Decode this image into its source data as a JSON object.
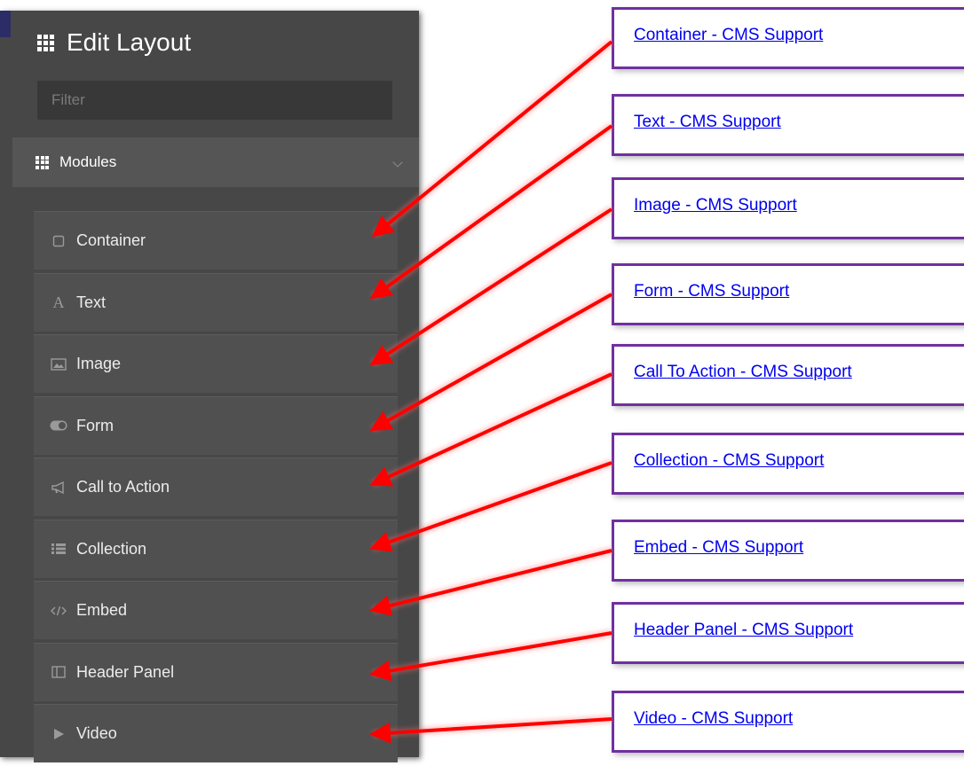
{
  "sidebar": {
    "title": "Edit Layout",
    "filter_placeholder": "Filter",
    "section_label": "Modules",
    "items": [
      {
        "label": "Container",
        "icon": "square-outline-icon"
      },
      {
        "label": "Text",
        "icon": "text-a-icon"
      },
      {
        "label": "Image",
        "icon": "image-icon"
      },
      {
        "label": "Form",
        "icon": "toggle-icon"
      },
      {
        "label": "Call to Action",
        "icon": "megaphone-icon"
      },
      {
        "label": "Collection",
        "icon": "list-icon"
      },
      {
        "label": "Embed",
        "icon": "code-icon"
      },
      {
        "label": "Header Panel",
        "icon": "panel-icon"
      },
      {
        "label": "Video",
        "icon": "play-icon"
      }
    ]
  },
  "links": [
    "Container - CMS Support",
    "Text - CMS Support",
    "Image - CMS Support",
    "Form - CMS Support",
    "Call To Action - CMS Support",
    "Collection - CMS Support",
    "Embed - CMS Support",
    "Header Panel - CMS Support",
    "Video - CMS Support"
  ],
  "colors": {
    "panel_bg": "#474747",
    "item_bg": "#505050",
    "link": "#0000ee",
    "box_border": "#7030a0",
    "arrow": "#ff0000"
  }
}
